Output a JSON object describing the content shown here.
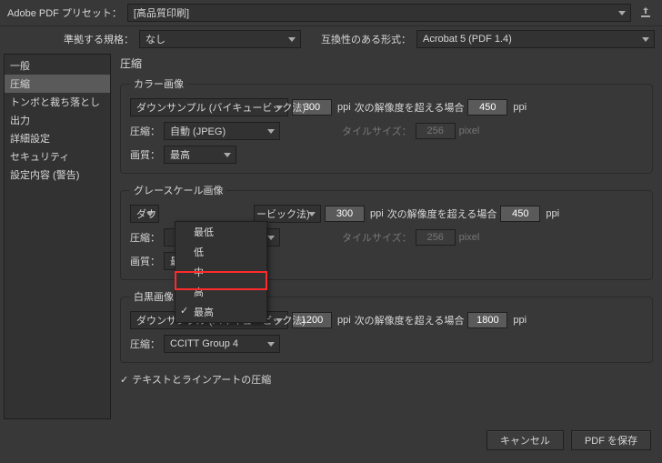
{
  "header": {
    "preset_label": "Adobe PDF プリセット：",
    "preset_value": "[高品質印刷]",
    "export_tooltip": "書き出し"
  },
  "row2": {
    "standard_label": "準拠する規格：",
    "standard_value": "なし",
    "compat_label": "互換性のある形式：",
    "compat_value": "Acrobat 5 (PDF 1.4)"
  },
  "sidebar": {
    "items": [
      "一般",
      "圧縮",
      "トンボと裁ち落とし",
      "出力",
      "詳細設定",
      "セキュリティ",
      "設定内容 (警告)"
    ],
    "selected": 1
  },
  "main": {
    "title": "圧縮",
    "color": {
      "legend": "カラー画像",
      "downsample": "ダウンサンプル (バイキュービック法)",
      "ppi1": "300",
      "over_label": "次の解像度を超える場合",
      "ppi2": "450",
      "compress_label": "圧縮：",
      "compress_value": "自動 (JPEG)",
      "tilesize_label": "タイルサイズ：",
      "tilesize_value": "256",
      "pixel": "pixel",
      "quality_label": "画質：",
      "quality_value": "最高"
    },
    "gray": {
      "legend": "グレースケール画像",
      "downsample_left": "ダウ",
      "downsample_right": "ービック法)",
      "ppi1": "300",
      "over_label": "次の解像度を超える場合",
      "ppi2": "450",
      "compress_label": "圧縮：",
      "tilesize_label": "タイルサイズ：",
      "tilesize_value": "256",
      "pixel": "pixel",
      "quality_label": "画質：",
      "quality_value": "最高"
    },
    "mono": {
      "legend": "白黒画像",
      "downsample": "ダウンサンプル (バイキュービック法)",
      "ppi1": "1200",
      "over_label": "次の解像度を超える場合",
      "ppi2": "1800",
      "compress_label": "圧縮：",
      "compress_value": "CCITT Group 4"
    },
    "text_compress": "テキストとラインアートの圧縮",
    "ppi": "ppi"
  },
  "dropdown": {
    "options": [
      "最低",
      "低",
      "中",
      "高",
      "最高"
    ],
    "checked": 4,
    "highlighted": 3
  },
  "footer": {
    "cancel": "キャンセル",
    "save": "PDF を保存"
  }
}
